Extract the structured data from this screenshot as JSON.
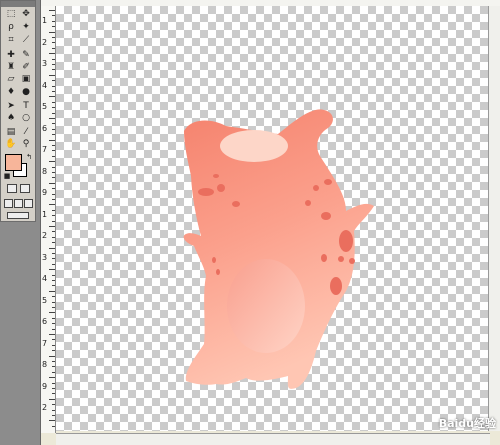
{
  "tools": {
    "rows": [
      [
        "marquee",
        "move"
      ],
      [
        "lasso",
        "magic-wand"
      ],
      [
        "crop",
        "slice"
      ],
      [
        "healing-brush",
        "brush"
      ],
      [
        "clone-stamp",
        "history-brush"
      ],
      [
        "eraser",
        "gradient"
      ],
      [
        "blur",
        "dodge"
      ],
      [
        "path-selection",
        "type"
      ],
      [
        "pen",
        "shape"
      ],
      [
        "notes",
        "eyedropper"
      ],
      [
        "hand",
        "zoom"
      ]
    ]
  },
  "colors": {
    "foreground": "#f7b59a",
    "background": "#ffffff"
  },
  "ruler": {
    "left_labels": [
      "1",
      "2",
      "3",
      "4",
      "5",
      "6",
      "7",
      "8",
      "9",
      "1",
      "2",
      "3",
      "4",
      "5",
      "6",
      "7",
      "8",
      "9",
      "2"
    ]
  },
  "watermark": "Baidu经验"
}
